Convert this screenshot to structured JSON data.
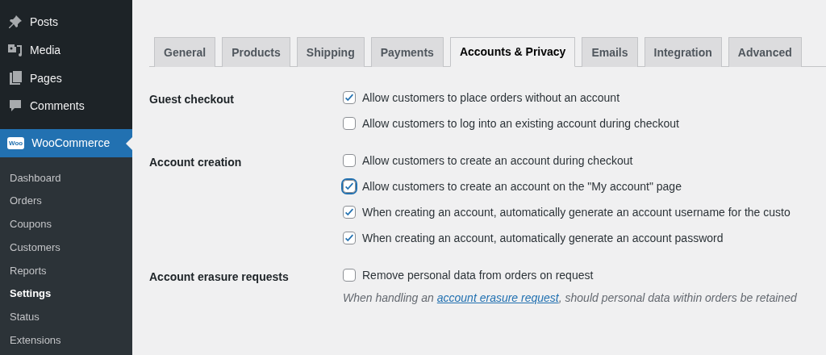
{
  "sidebar": {
    "items": [
      {
        "label": "Posts"
      },
      {
        "label": "Media"
      },
      {
        "label": "Pages"
      },
      {
        "label": "Comments"
      }
    ],
    "active_menu": {
      "label": "WooCommerce",
      "logo": "Woo"
    },
    "submenu": [
      {
        "label": "Dashboard",
        "selected": false
      },
      {
        "label": "Orders",
        "selected": false
      },
      {
        "label": "Coupons",
        "selected": false
      },
      {
        "label": "Customers",
        "selected": false
      },
      {
        "label": "Reports",
        "selected": false
      },
      {
        "label": "Settings",
        "selected": true
      },
      {
        "label": "Status",
        "selected": false
      },
      {
        "label": "Extensions",
        "selected": false
      }
    ]
  },
  "tabs": [
    {
      "label": "General",
      "selected": false
    },
    {
      "label": "Products",
      "selected": false
    },
    {
      "label": "Shipping",
      "selected": false
    },
    {
      "label": "Payments",
      "selected": false
    },
    {
      "label": "Accounts & Privacy",
      "selected": true
    },
    {
      "label": "Emails",
      "selected": false
    },
    {
      "label": "Integration",
      "selected": false
    },
    {
      "label": "Advanced",
      "selected": false
    }
  ],
  "sections": [
    {
      "label": "Guest checkout",
      "options": [
        {
          "label": "Allow customers to place orders without an account",
          "checked": true,
          "focused": false
        },
        {
          "label": "Allow customers to log into an existing account during checkout",
          "checked": false,
          "focused": false
        }
      ]
    },
    {
      "label": "Account creation",
      "options": [
        {
          "label": "Allow customers to create an account during checkout",
          "checked": false,
          "focused": false
        },
        {
          "label": "Allow customers to create an account on the \"My account\" page",
          "checked": true,
          "focused": true
        },
        {
          "label": "When creating an account, automatically generate an account username for the custo",
          "checked": true,
          "focused": false
        },
        {
          "label": "When creating an account, automatically generate an account password",
          "checked": true,
          "focused": false
        }
      ]
    },
    {
      "label": "Account erasure requests",
      "options": [
        {
          "label": "Remove personal data from orders on request",
          "checked": false,
          "focused": false
        }
      ],
      "description": {
        "before": "When handling an ",
        "link": "account erasure request",
        "after": ", should personal data within orders be retained"
      }
    }
  ]
}
